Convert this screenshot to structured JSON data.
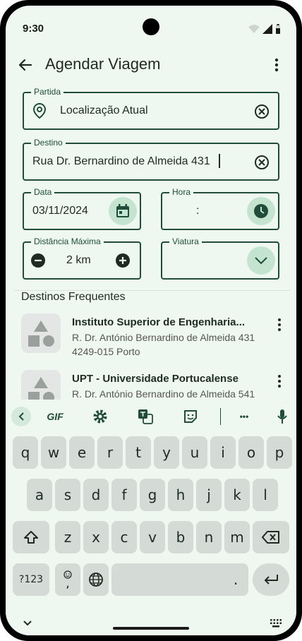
{
  "status": {
    "time": "9:30"
  },
  "appbar": {
    "title": "Agendar Viagem"
  },
  "form": {
    "partida": {
      "label": "Partida",
      "value": "Localização Atual"
    },
    "destino": {
      "label": "Destino",
      "value": "Rua Dr. Bernardino de Almeida 431"
    },
    "data": {
      "label": "Data",
      "value": "03/11/2024"
    },
    "hora": {
      "label": "Hora",
      "value": ":"
    },
    "distancia": {
      "label": "Distância Máxima",
      "value": "2 km"
    },
    "viatura": {
      "label": "Viatura",
      "value": ""
    }
  },
  "frequent": {
    "title": "Destinos Frequentes",
    "items": [
      {
        "name": "Instituto Superior de Engenharia...",
        "line1": "R. Dr. António Bernardino de Almeida 431",
        "line2": "4249-015 Porto"
      },
      {
        "name": "UPT - Universidade Portucalense",
        "line1": "R. Dr. António Bernardino de Almeida 541",
        "line2": ""
      }
    ]
  },
  "keyboard": {
    "toolbar": {
      "gif": "GIF",
      "more": "•••"
    },
    "row1": [
      "q",
      "w",
      "e",
      "r",
      "t",
      "y",
      "u",
      "i",
      "o",
      "p"
    ],
    "row2": [
      "a",
      "s",
      "d",
      "f",
      "g",
      "h",
      "j",
      "k",
      "l"
    ],
    "row3": [
      "z",
      "x",
      "c",
      "v",
      "b",
      "n",
      "m"
    ],
    "symbols": "?123",
    "emoji_comma": ",",
    "period": "."
  },
  "colors": {
    "accent": "#1f4d3a",
    "background": "#eef8f1",
    "button_fill": "#c4e4d0"
  }
}
